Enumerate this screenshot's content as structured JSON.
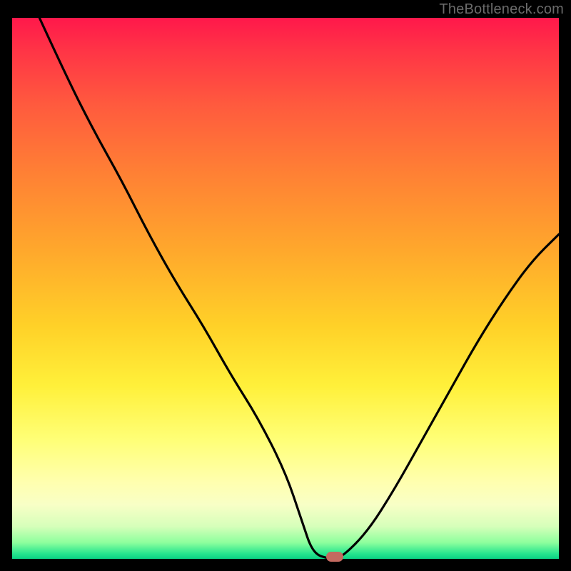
{
  "watermark": {
    "text": "TheBottleneck.com"
  },
  "colors": {
    "page_bg": "#000000",
    "curve": "#000000",
    "marker": "#c46a60",
    "watermark": "#6b6b6b"
  },
  "chart_data": {
    "type": "line",
    "title": "",
    "xlabel": "",
    "ylabel": "",
    "xlim": [
      0,
      100
    ],
    "ylim": [
      0,
      100
    ],
    "grid": false,
    "legend": false,
    "gradient_stops": [
      {
        "pos": 0,
        "color": "#ff184b"
      },
      {
        "pos": 6,
        "color": "#ff3446"
      },
      {
        "pos": 16,
        "color": "#ff5a3e"
      },
      {
        "pos": 29,
        "color": "#ff8134"
      },
      {
        "pos": 43,
        "color": "#ffa82c"
      },
      {
        "pos": 57,
        "color": "#ffd128"
      },
      {
        "pos": 68,
        "color": "#fff03a"
      },
      {
        "pos": 78,
        "color": "#ffff77"
      },
      {
        "pos": 86,
        "color": "#ffffb0"
      },
      {
        "pos": 90,
        "color": "#f8ffc6"
      },
      {
        "pos": 94,
        "color": "#d6ffba"
      },
      {
        "pos": 97,
        "color": "#8dff9d"
      },
      {
        "pos": 99,
        "color": "#28e58e"
      },
      {
        "pos": 100,
        "color": "#0ad184"
      }
    ],
    "series": [
      {
        "name": "bottleneck-curve",
        "x": [
          5,
          10,
          15,
          20,
          25,
          30,
          35,
          40,
          45,
          50,
          53,
          55,
          58,
          60,
          65,
          70,
          75,
          80,
          85,
          90,
          95,
          100
        ],
        "y": [
          100,
          89,
          79,
          70,
          60,
          51,
          43,
          34,
          26,
          16,
          7,
          1,
          0,
          0,
          5,
          13,
          22,
          31,
          40,
          48,
          55,
          60
        ]
      }
    ],
    "marker": {
      "x": 59,
      "y": 0
    }
  }
}
